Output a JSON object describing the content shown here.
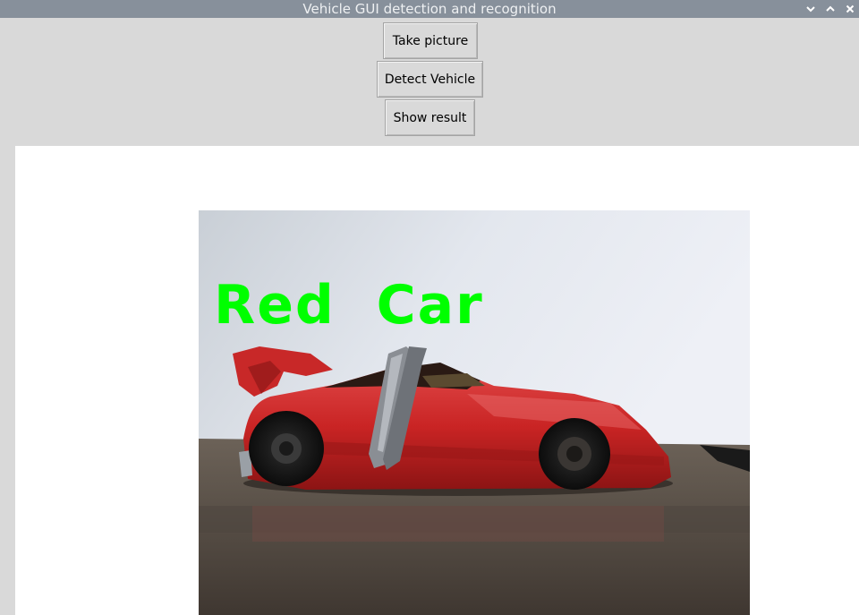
{
  "window": {
    "title": "Vehicle GUI detection and recognition"
  },
  "window_controls": {
    "minimize_icon": "chevron-down-icon",
    "maximize_icon": "chevron-up-icon",
    "close_icon": "close-icon"
  },
  "buttons": {
    "take_picture": "Take picture",
    "detect_vehicle": "Detect Vehicle",
    "show_result": "Show result"
  },
  "result": {
    "label": "Red  Car",
    "label_color": "#00ff00"
  },
  "colors": {
    "titlebar": "#87909b",
    "background": "#d9d9d9",
    "canvas": "#ffffff"
  }
}
